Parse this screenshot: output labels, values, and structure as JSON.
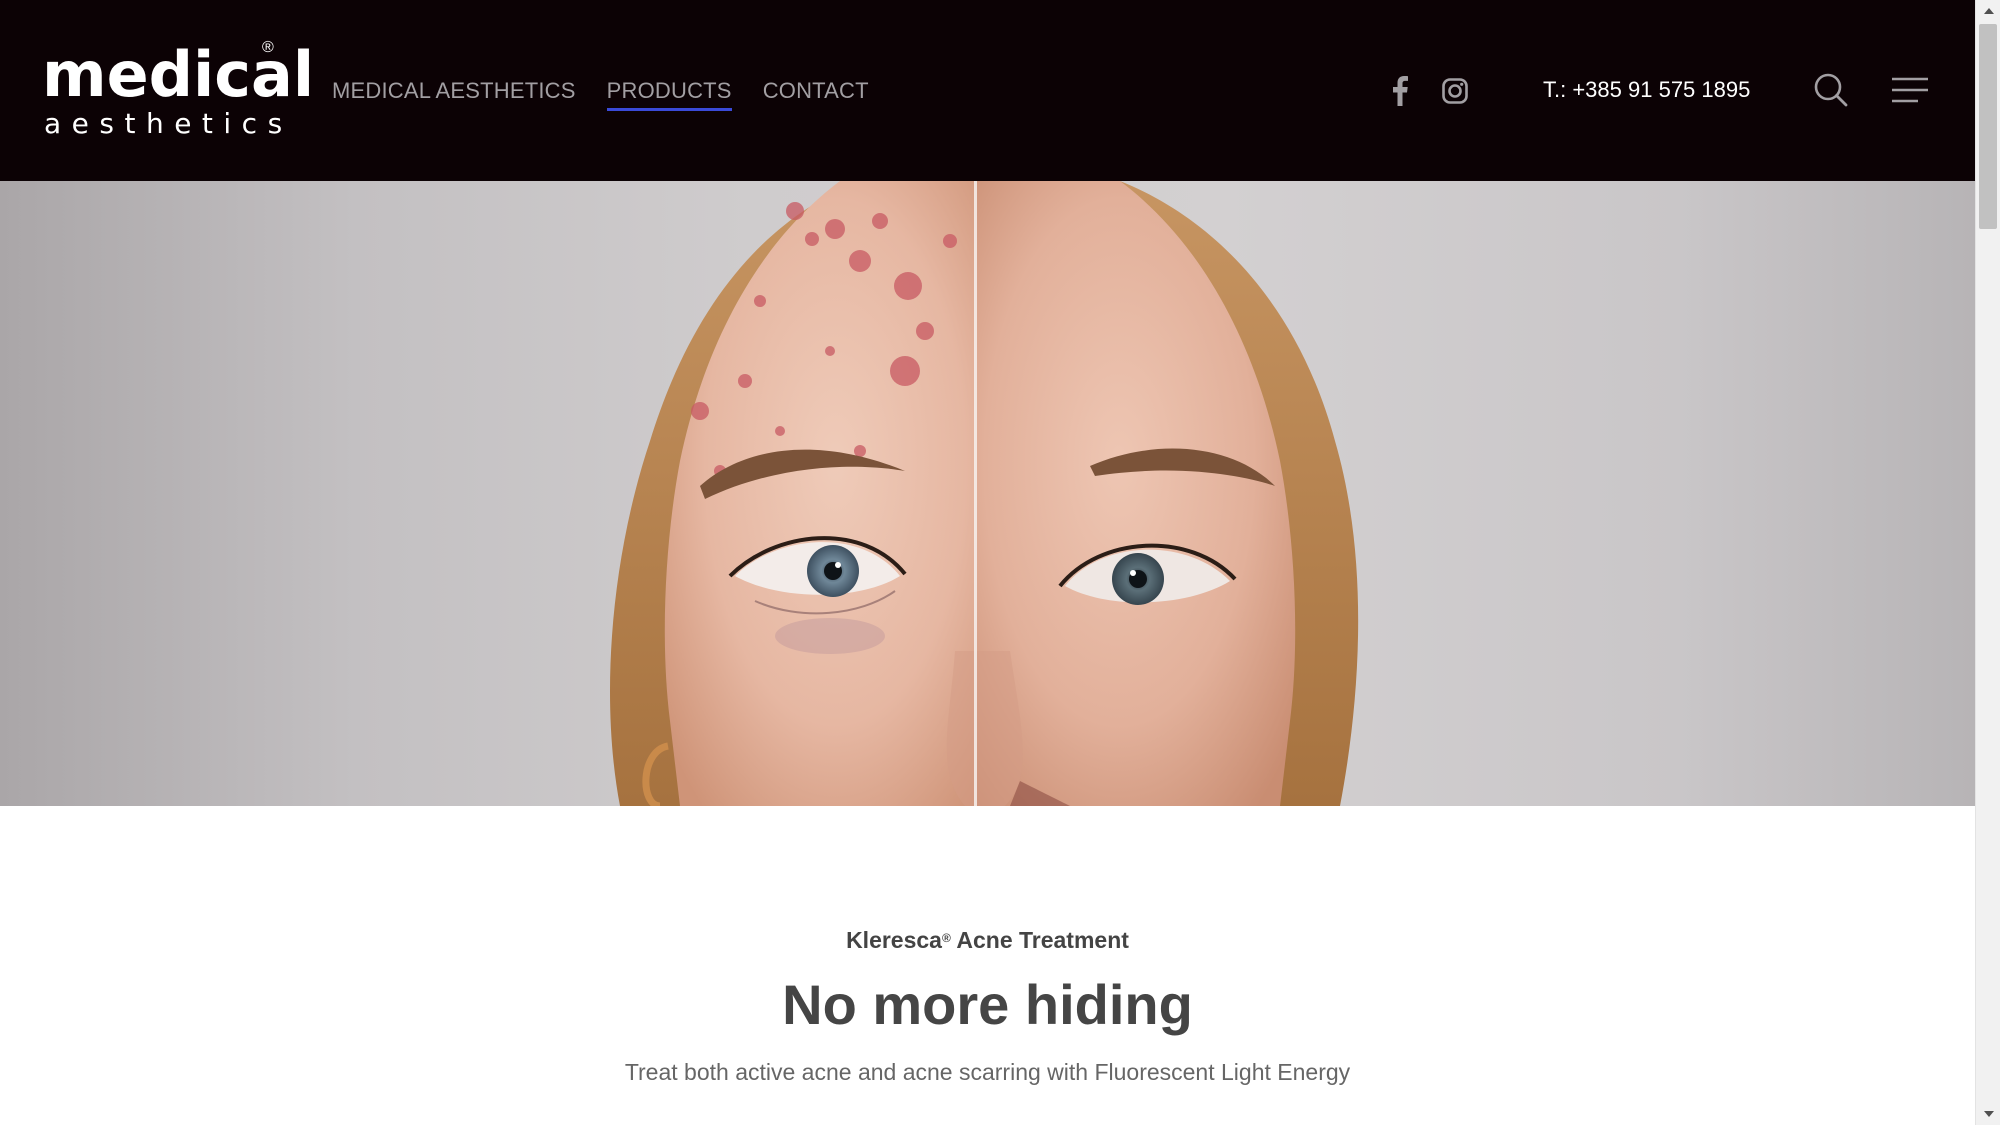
{
  "logo": {
    "main": "medical",
    "sub": "aesthetics",
    "registered": "®"
  },
  "nav": {
    "items": [
      {
        "label": "MEDICAL AESTHETICS",
        "active": false
      },
      {
        "label": "PRODUCTS",
        "active": true
      },
      {
        "label": "CONTACT",
        "active": false
      }
    ]
  },
  "social": {
    "facebook_icon": "facebook-icon",
    "instagram_icon": "instagram-icon"
  },
  "contact": {
    "phone": "T.: +385 91 575 1895"
  },
  "header_actions": {
    "search_icon": "search-icon",
    "menu_icon": "hamburger-menu-icon"
  },
  "hero": {
    "image": "before-after-face-photo"
  },
  "content": {
    "eyebrow_brand": "Kleresca",
    "eyebrow_mark": "®",
    "eyebrow_rest": " Acne Treatment",
    "headline": "No more hiding",
    "subline": "Treat both active acne and acne scarring with Fluorescent Light Energy"
  },
  "colors": {
    "header_bg": "#0c0205",
    "nav_text": "#a29fa3",
    "nav_active_underline": "#3a4ad8",
    "headline_text": "#454545"
  }
}
